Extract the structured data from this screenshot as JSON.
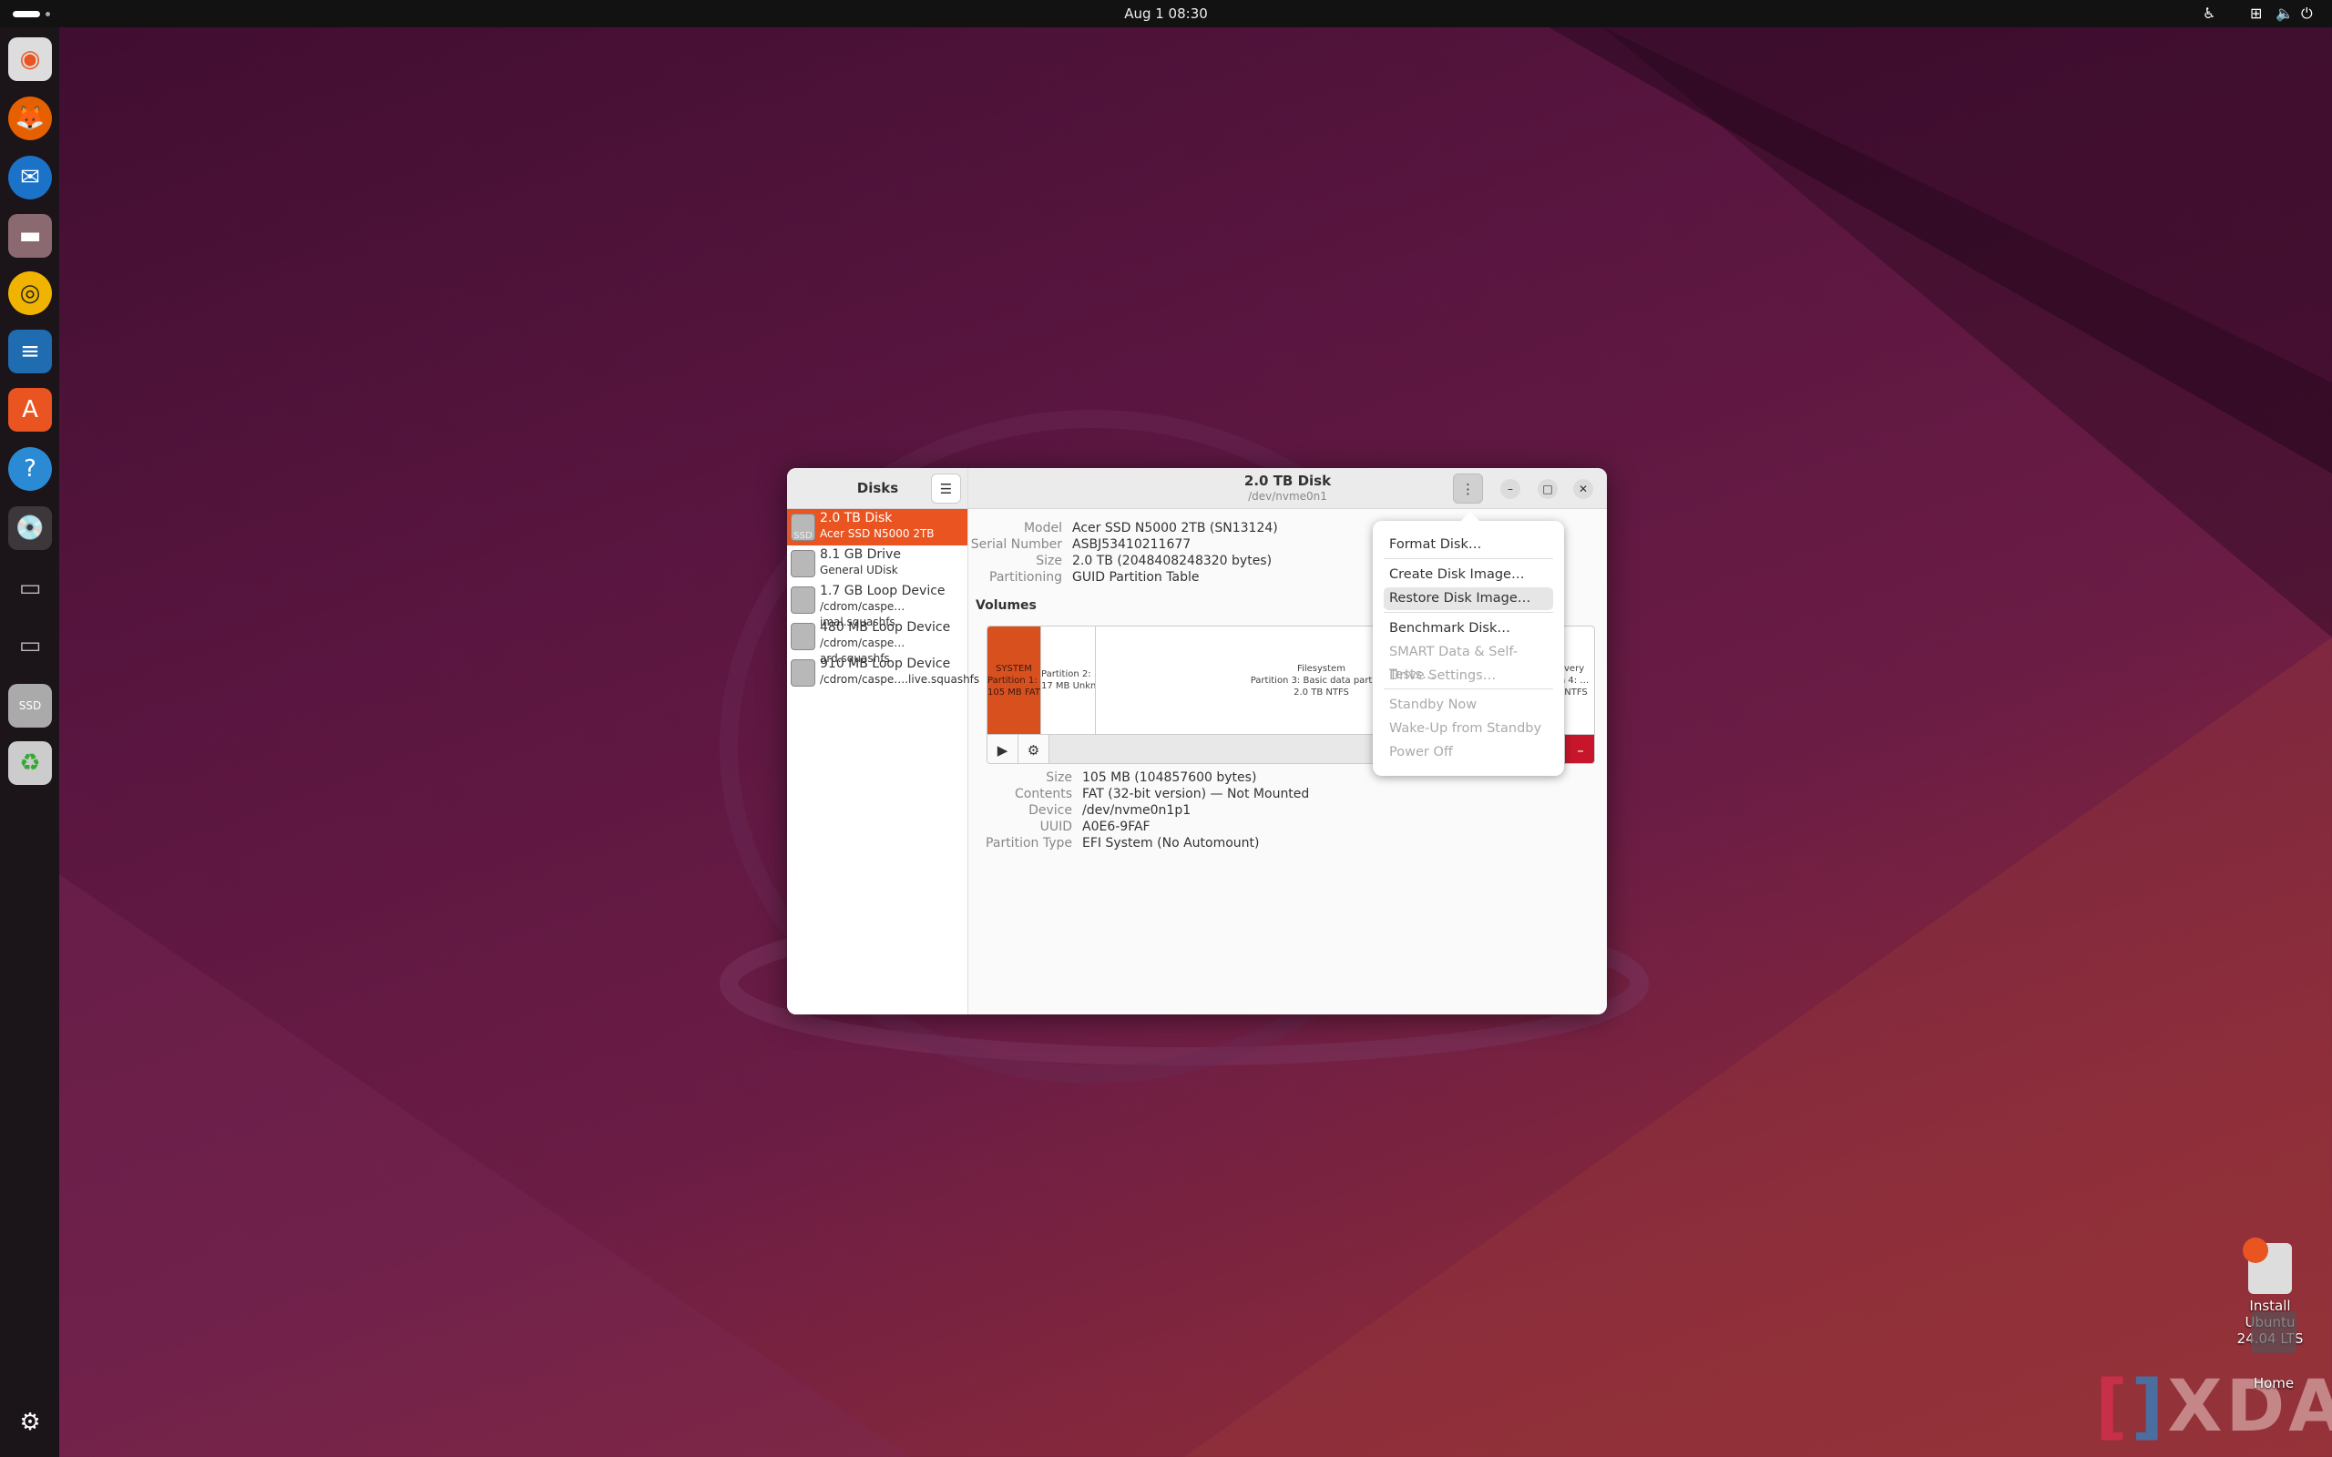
{
  "topbar": {
    "clock": "Aug 1  08:30",
    "tray_icons": [
      "accessibility-icon",
      "network-icon",
      "volume-icon",
      "power-icon"
    ]
  },
  "dock": {
    "apps": [
      "ubuntu-installer",
      "firefox",
      "thunderbird",
      "files",
      "rhythmbox",
      "libreoffice-writer",
      "app-center",
      "help",
      "disks",
      "drive",
      "drive",
      "ssd",
      "trash"
    ],
    "active": "disks"
  },
  "window": {
    "sidebar": {
      "title": "Disks",
      "disks": [
        {
          "name": "2.0 TB Disk",
          "sub": "Acer SSD N5000 2TB",
          "icon": "ssd-icon",
          "selected": true
        },
        {
          "name": "8.1 GB Drive",
          "sub": "General UDisk",
          "icon": "usb-drive-icon"
        },
        {
          "name": "1.7 GB Loop Device",
          "sub": "/cdrom/caspe…imal.squashfs",
          "icon": "drive-icon"
        },
        {
          "name": "480 MB Loop Device",
          "sub": "/cdrom/caspe…  ard.squashfs",
          "icon": "drive-icon"
        },
        {
          "name": "910 MB Loop Device",
          "sub": "/cdrom/caspe….live.squashfs",
          "icon": "drive-icon"
        }
      ]
    },
    "header": {
      "title": "2.0 TB Disk",
      "subtitle": "/dev/nvme0n1"
    },
    "disk_info": [
      {
        "k": "Model",
        "v": "Acer SSD N5000 2TB (SN13124)"
      },
      {
        "k": "Serial Number",
        "v": "ASBJ53410211677"
      },
      {
        "k": "Size",
        "v": "2.0 TB (2048408248320 bytes)"
      },
      {
        "k": "Partitioning",
        "v": "GUID Partition Table"
      }
    ],
    "volumes_label": "Volumes",
    "partitions": [
      {
        "l1": "SYSTEM",
        "l2": "Partition 1: E…",
        "l3": "105 MB FAT",
        "selected": true
      },
      {
        "l1": "Partition 2: …",
        "l2": "17 MB Unkn…",
        "l3": ""
      },
      {
        "l1": "Filesystem",
        "l2": "Partition 3: Basic data partition",
        "l3": "2.0 TB NTFS"
      },
      {
        "l1": "overy",
        "l2": "on 4: …",
        "l3": "B NTFS"
      }
    ],
    "partition_info": [
      {
        "k": "Size",
        "v": "105 MB (104857600 bytes)"
      },
      {
        "k": "Contents",
        "v": "FAT (32-bit version) — Not Mounted"
      },
      {
        "k": "Device",
        "v": "/dev/nvme0n1p1"
      },
      {
        "k": "UUID",
        "v": "A0E6-9FAF"
      },
      {
        "k": "Partition Type",
        "v": "EFI System (No Automount)"
      }
    ],
    "menu": [
      {
        "label": "Format Disk…"
      },
      {
        "label": "Create Disk Image…"
      },
      {
        "label": "Restore Disk Image…",
        "highlighted": true
      },
      {
        "label": "Benchmark Disk…"
      },
      {
        "label": "SMART Data & Self-Tests…",
        "disabled": true
      },
      {
        "label": "Drive Settings…",
        "disabled": true
      },
      {
        "label": "Standby Now",
        "disabled": true
      },
      {
        "label": "Wake-Up from Standby",
        "disabled": true
      },
      {
        "label": "Power Off",
        "disabled": true
      }
    ]
  },
  "desktop": {
    "install_label": "Install Ubuntu\n24.04 LTS",
    "home_label": "Home",
    "watermark": "XDA"
  },
  "colors": {
    "accent": "#e95420",
    "danger": "#c7162b"
  }
}
